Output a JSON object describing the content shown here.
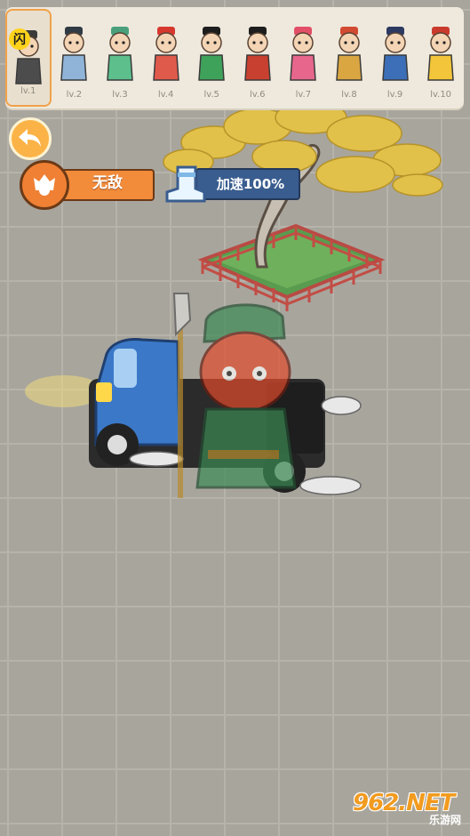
{
  "top_bar": {
    "slots": [
      {
        "level": "lv.1",
        "selected": true,
        "hat": "#3a3a3a",
        "robe": "#4c4c4c"
      },
      {
        "level": "lv.2",
        "selected": false,
        "hat": "#2f3a44",
        "robe": "#8fb4d8"
      },
      {
        "level": "lv.3",
        "selected": false,
        "hat": "#49a07a",
        "robe": "#5cbf8c"
      },
      {
        "level": "lv.4",
        "selected": false,
        "hat": "#d7382e",
        "robe": "#e05a4c"
      },
      {
        "level": "lv.5",
        "selected": false,
        "hat": "#1d1d1d",
        "robe": "#3fa25a"
      },
      {
        "level": "lv.6",
        "selected": false,
        "hat": "#1d1d1d",
        "robe": "#c8402f"
      },
      {
        "level": "lv.7",
        "selected": false,
        "hat": "#e24f67",
        "robe": "#e7668c"
      },
      {
        "level": "lv.8",
        "selected": false,
        "hat": "#d24a32",
        "robe": "#d9a642"
      },
      {
        "level": "lv.9",
        "selected": false,
        "hat": "#2c3a62",
        "robe": "#3c6fb8"
      },
      {
        "level": "lv.10",
        "selected": false,
        "hat": "#c93a2c",
        "robe": "#f2c53a"
      }
    ],
    "flash_badge": "闪"
  },
  "buttons": {
    "back_icon": "back-arrow-icon",
    "invincible_label": "无敌",
    "speed_label": "加速100%"
  },
  "colors": {
    "orange": "#f28b3a",
    "blue_bar": "#3a5d8f",
    "ground": "#a8a59d"
  },
  "watermark": {
    "number": "962",
    "suffix": ".NET",
    "sub": "乐游网"
  }
}
